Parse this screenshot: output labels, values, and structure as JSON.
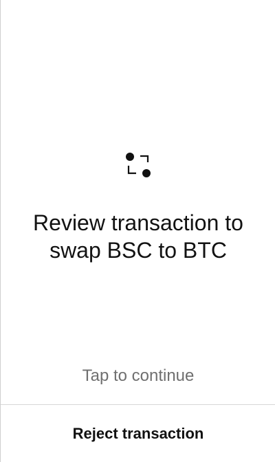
{
  "screen": {
    "icon": "swap-icon",
    "title_line1": "Review transaction to",
    "title_line2": "swap BSC to BTC",
    "hint": "Tap to continue",
    "reject_label": "Reject transaction"
  },
  "colors": {
    "background": "#ffffff",
    "text": "#111111",
    "muted": "#6f6f6f",
    "divider": "#d7d7d7"
  }
}
